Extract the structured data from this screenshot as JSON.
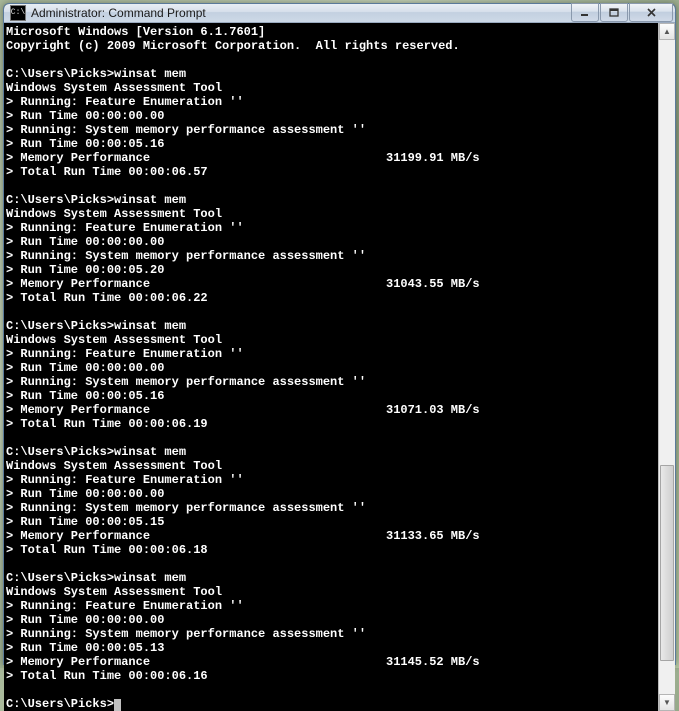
{
  "window": {
    "title": "Administrator: Command Prompt"
  },
  "banner": {
    "l1": "Microsoft Windows [Version 6.1.7601]",
    "l2": "Copyright (c) 2009 Microsoft Corporation.  All rights reserved."
  },
  "prompt_path": "C:\\Users\\Picks>",
  "command": "winsat mem",
  "tool_name": "Windows System Assessment Tool",
  "step_feat": "> Running: Feature Enumeration ''",
  "step_mem": "> Running: System memory performance assessment ''",
  "rt_label": "> Run Time ",
  "mp_label": "> Memory Performance",
  "total_label": "> Total Run Time ",
  "runs": [
    {
      "rt1": "00:00:00.00",
      "rt2": "00:00:05.16",
      "mbps": "31199.91 MB/s",
      "total": "00:00:06.57"
    },
    {
      "rt1": "00:00:00.00",
      "rt2": "00:00:05.20",
      "mbps": "31043.55 MB/s",
      "total": "00:00:06.22"
    },
    {
      "rt1": "00:00:00.00",
      "rt2": "00:00:05.16",
      "mbps": "31071.03 MB/s",
      "total": "00:00:06.19"
    },
    {
      "rt1": "00:00:00.00",
      "rt2": "00:00:05.15",
      "mbps": "31133.65 MB/s",
      "total": "00:00:06.18"
    },
    {
      "rt1": "00:00:00.00",
      "rt2": "00:00:05.13",
      "mbps": "31145.52 MB/s",
      "total": "00:00:06.16"
    }
  ]
}
